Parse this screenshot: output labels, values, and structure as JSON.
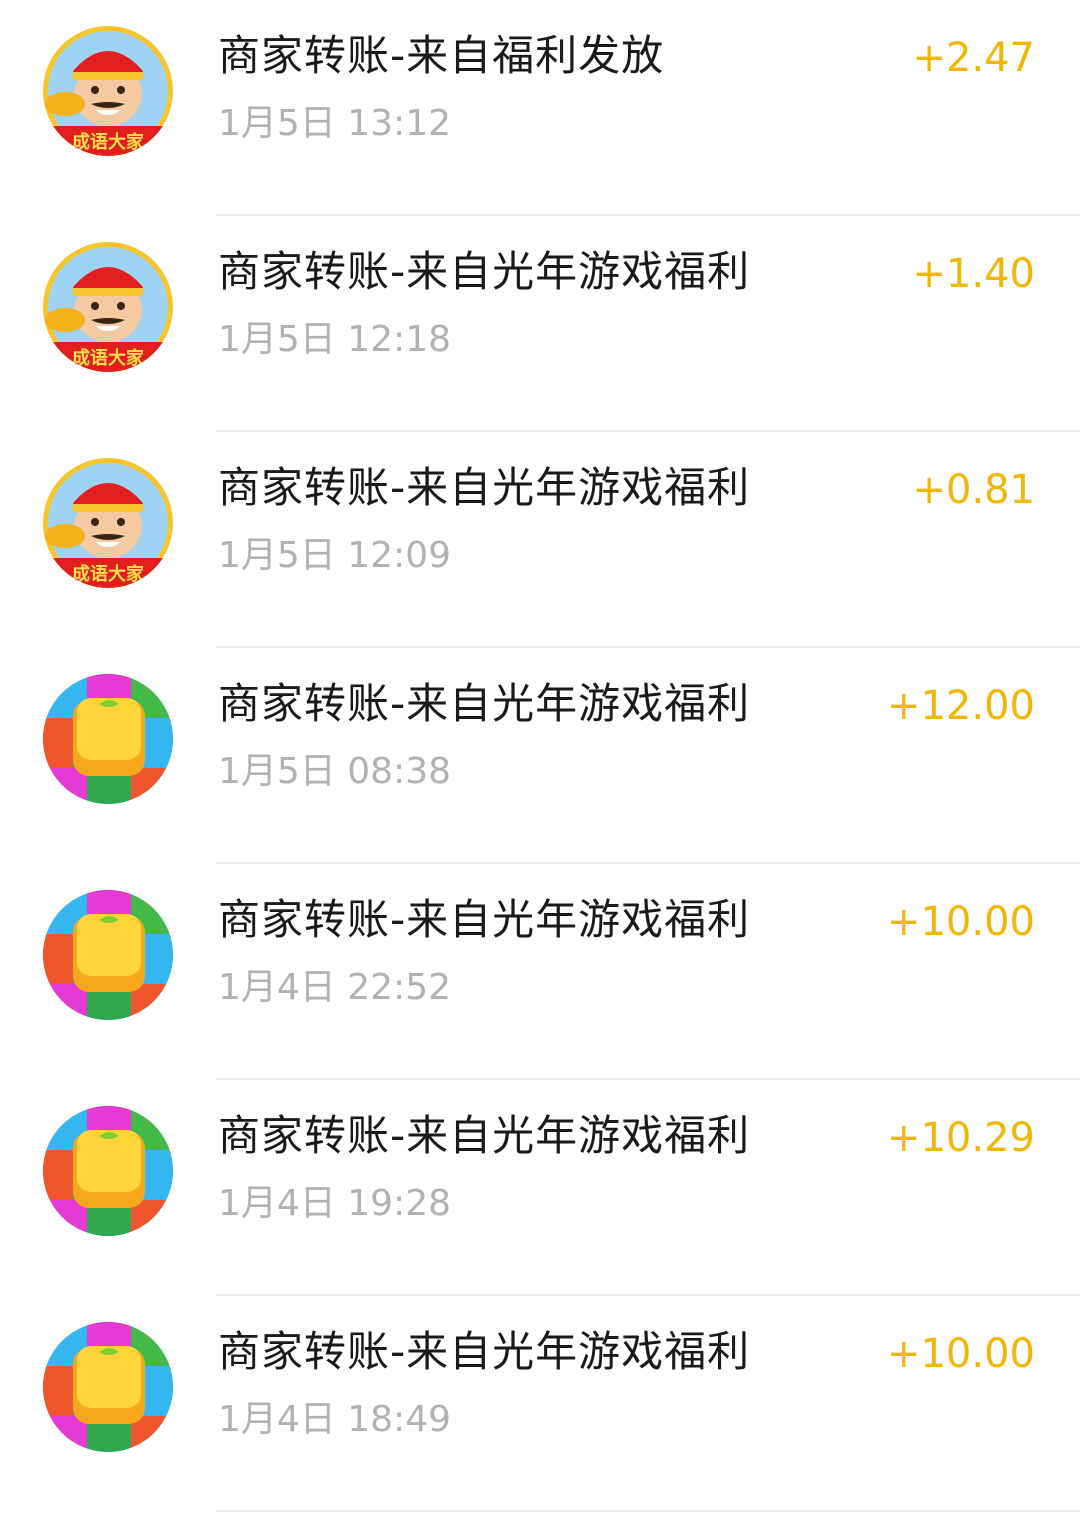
{
  "transactions": [
    {
      "avatar_icon": "idiom-game-icon",
      "title": "商家转账-来自福利发放",
      "time": "1月5日 13:12",
      "amount": "+2.47"
    },
    {
      "avatar_icon": "idiom-game-icon",
      "title": "商家转账-来自光年游戏福利",
      "time": "1月5日 12:18",
      "amount": "+1.40"
    },
    {
      "avatar_icon": "idiom-game-icon",
      "title": "商家转账-来自光年游戏福利",
      "time": "1月5日 12:09",
      "amount": "+0.81"
    },
    {
      "avatar_icon": "block-puzzle-game-icon",
      "title": "商家转账-来自光年游戏福利",
      "time": "1月5日 08:38",
      "amount": "+12.00"
    },
    {
      "avatar_icon": "block-puzzle-game-icon",
      "title": "商家转账-来自光年游戏福利",
      "time": "1月4日 22:52",
      "amount": "+10.00"
    },
    {
      "avatar_icon": "block-puzzle-game-icon",
      "title": "商家转账-来自光年游戏福利",
      "time": "1月4日 19:28",
      "amount": "+10.29"
    },
    {
      "avatar_icon": "block-puzzle-game-icon",
      "title": "商家转账-来自光年游戏福利",
      "time": "1月4日 18:49",
      "amount": "+10.00"
    }
  ],
  "avatar_logo_text": "成语大家",
  "colors": {
    "amount": "#f2b705",
    "title": "#1a1a1a",
    "time": "#b2b2b2",
    "divider": "#ebebeb"
  }
}
